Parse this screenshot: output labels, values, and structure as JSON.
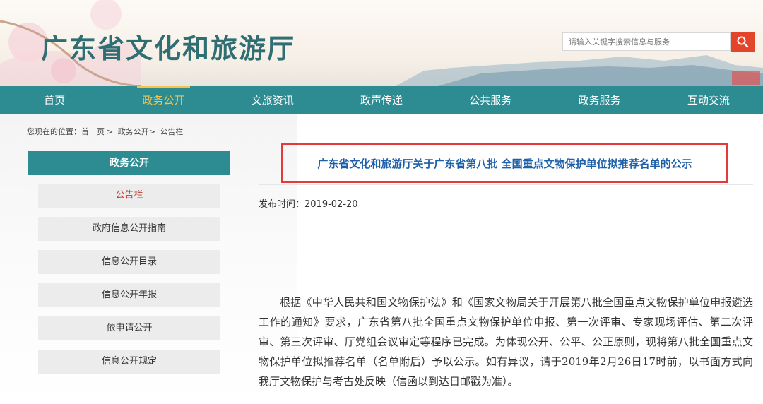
{
  "header": {
    "site_title": "广东省文化和旅游厅",
    "search_placeholder": "请输入关键字搜索信息与服务",
    "search_icon": "search-icon",
    "accent_color": "#2d8c92",
    "search_button_color": "#e2452a"
  },
  "nav": {
    "items": [
      {
        "label": "首页"
      },
      {
        "label": "政务公开"
      },
      {
        "label": "文旅资讯"
      },
      {
        "label": "政声传递"
      },
      {
        "label": "公共服务"
      },
      {
        "label": "政务服务"
      },
      {
        "label": "互动交流"
      }
    ],
    "active_index": 1,
    "active_color": "#f6c34a"
  },
  "breadcrumb": {
    "prefix": "您现在的位置：首　页",
    "sep": ">",
    "level1": "政务公开>",
    "level2": "公告栏"
  },
  "sidebar": {
    "heading": "政务公开",
    "items": [
      {
        "label": "公告栏"
      },
      {
        "label": "政府信息公开指南"
      },
      {
        "label": "信息公开目录"
      },
      {
        "label": "信息公开年报"
      },
      {
        "label": "依申请公开"
      },
      {
        "label": "信息公开规定"
      }
    ],
    "active_index": 0
  },
  "article": {
    "title": "广东省文化和旅游厅关于广东省第八批 全国重点文物保护单位拟推荐名单的公示",
    "pubtime_label": "发布时间：",
    "pubtime_value": "2019-02-20",
    "body": "根据《中华人民共和国文物保护法》和《国家文物局关于开展第八批全国重点文物保护单位申报遴选工作的通知》要求，广东省第八批全国重点文物保护单位申报、第一次评审、专家现场评估、第二次评审、第三次评审、厅党组会议审定等程序已完成。为体现公开、公平、公正原则，现将第八批全国重点文物保护单位拟推荐名单（名单附后）予以公示。如有异议，请于2019年2月26日17时前，以书面方式向我厅文物保护与考古处反映（信函以到达日邮戳为准）。",
    "title_color": "#1d5fa8",
    "highlight_border_color": "#e33b3b"
  }
}
